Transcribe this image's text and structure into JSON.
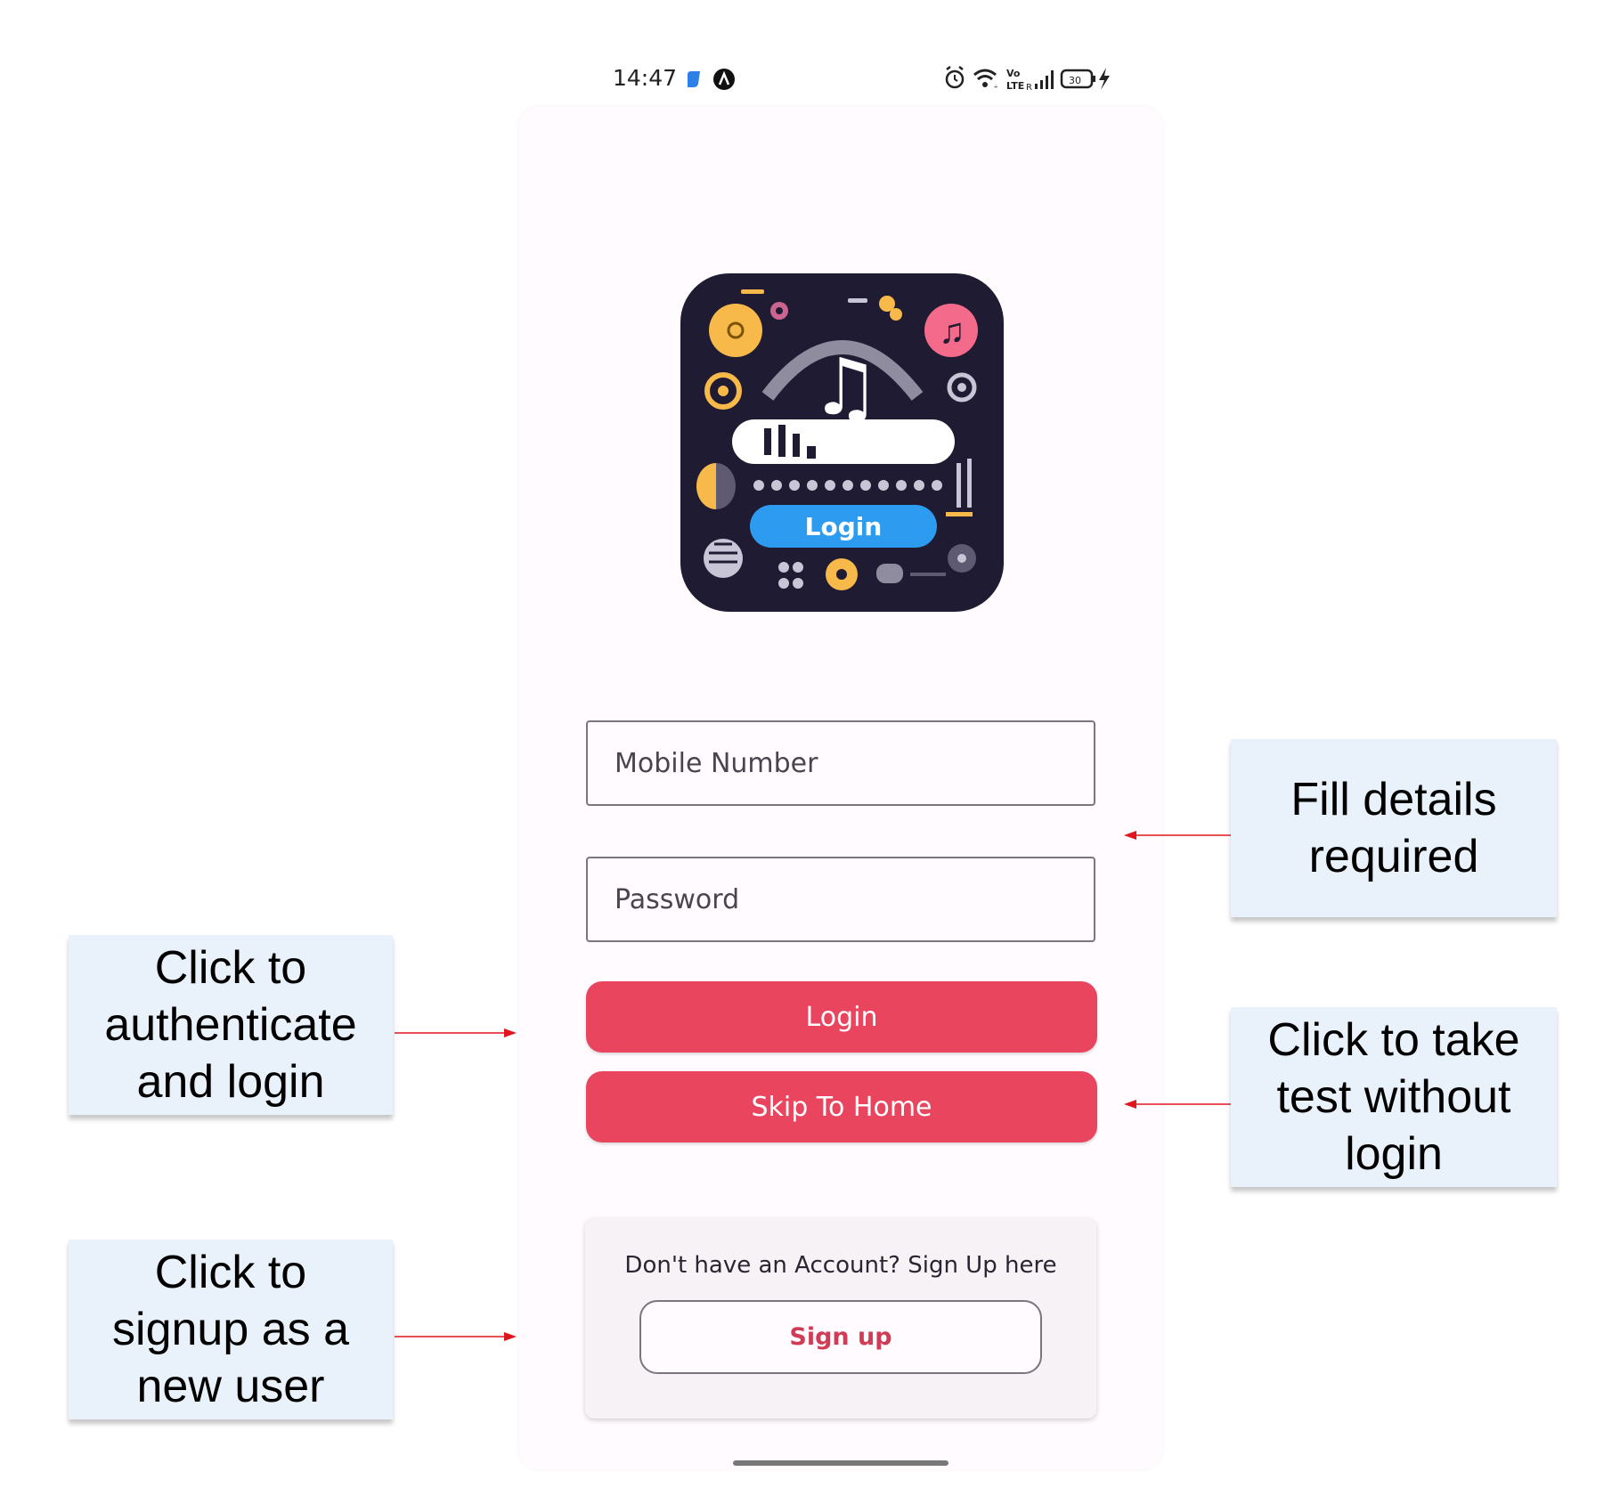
{
  "status_bar": {
    "time": "14:47"
  },
  "logo": {
    "label": "Login"
  },
  "form": {
    "mobile_placeholder": "Mobile Number",
    "password_placeholder": "Password",
    "login_label": "Login",
    "skip_label": "Skip To Home"
  },
  "signup_card": {
    "prompt": "Don't have an Account? Sign Up here",
    "signup_label": "Sign up"
  },
  "annotations": {
    "fill_details": [
      "Fill details",
      "required"
    ],
    "login": [
      "Click to",
      "authenticate",
      "and login"
    ],
    "skip": [
      "Click to take",
      "test without",
      "login"
    ],
    "signup": [
      "Click to",
      "signup as a",
      "new user"
    ]
  },
  "colors": {
    "primary": "#e9455f",
    "annotation_bg": "#e9f1fb",
    "arrow": "#e0161e"
  },
  "icons": [
    "app-badge-icon",
    "avatar-a-icon",
    "alarm-icon",
    "wifi-icon",
    "volte-icon",
    "signal-icon",
    "battery-icon",
    "charging-icon"
  ],
  "battery_level": "30"
}
